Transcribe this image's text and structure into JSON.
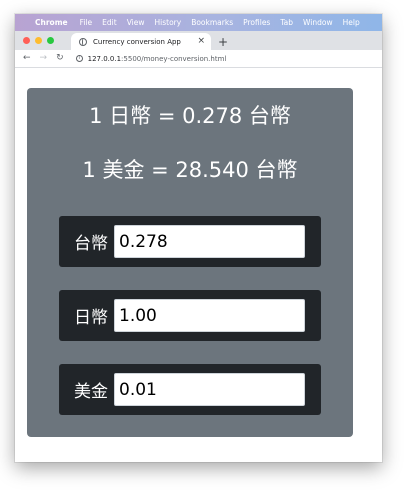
{
  "menubar": {
    "app_name": "Chrome",
    "items": [
      "File",
      "Edit",
      "View",
      "History",
      "Bookmarks",
      "Profiles",
      "Tab",
      "Window",
      "Help"
    ]
  },
  "browser": {
    "tab_title": "Currency conversion App",
    "tab_close": "×",
    "new_tab": "+",
    "url_host": "127.0.0.1",
    "url_path": ":5500/money-conversion.html",
    "back": "←",
    "forward": "→",
    "reload": "↻",
    "info": "i"
  },
  "rates": {
    "jpy_to_twd": "1 日幣 = 0.278 台幣",
    "usd_to_twd": "1 美金 = 28.540 台幣"
  },
  "fields": [
    {
      "label": "台幣",
      "value": "0.278"
    },
    {
      "label": "日幣",
      "value": "1.00"
    },
    {
      "label": "美金",
      "value": "0.01"
    }
  ],
  "colors": {
    "card_bg": "#6c757d",
    "group_bg": "#212529"
  }
}
